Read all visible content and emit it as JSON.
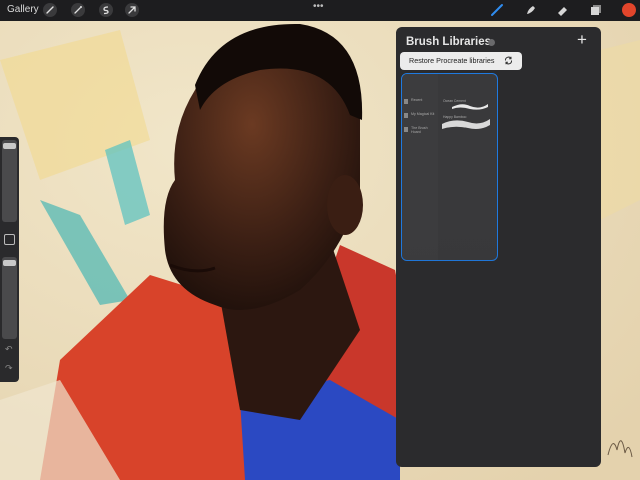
{
  "topbar": {
    "gallery_label": "Gallery",
    "left_icons": [
      "wrench-icon",
      "magic-wand-icon",
      "selection-s-icon",
      "transform-arrow-icon"
    ],
    "right_icons": [
      "brush-icon",
      "smudge-icon",
      "eraser-icon",
      "layers-icon"
    ],
    "active_tool": "brush",
    "current_color": "#e2452b"
  },
  "panel": {
    "title": "Brush Libraries",
    "restore_label": "Restore Procreate libraries",
    "libraries": [
      "Recent",
      "My Magical Kit",
      "The Brush Hoard"
    ],
    "brushes": [
      "Ocean Cement",
      "Happy Bamboo"
    ],
    "accent": "#1f7ae0"
  },
  "sidebar": {
    "controls": [
      "brush-size-slider",
      "modify-button",
      "opacity-slider",
      "undo",
      "redo"
    ]
  }
}
